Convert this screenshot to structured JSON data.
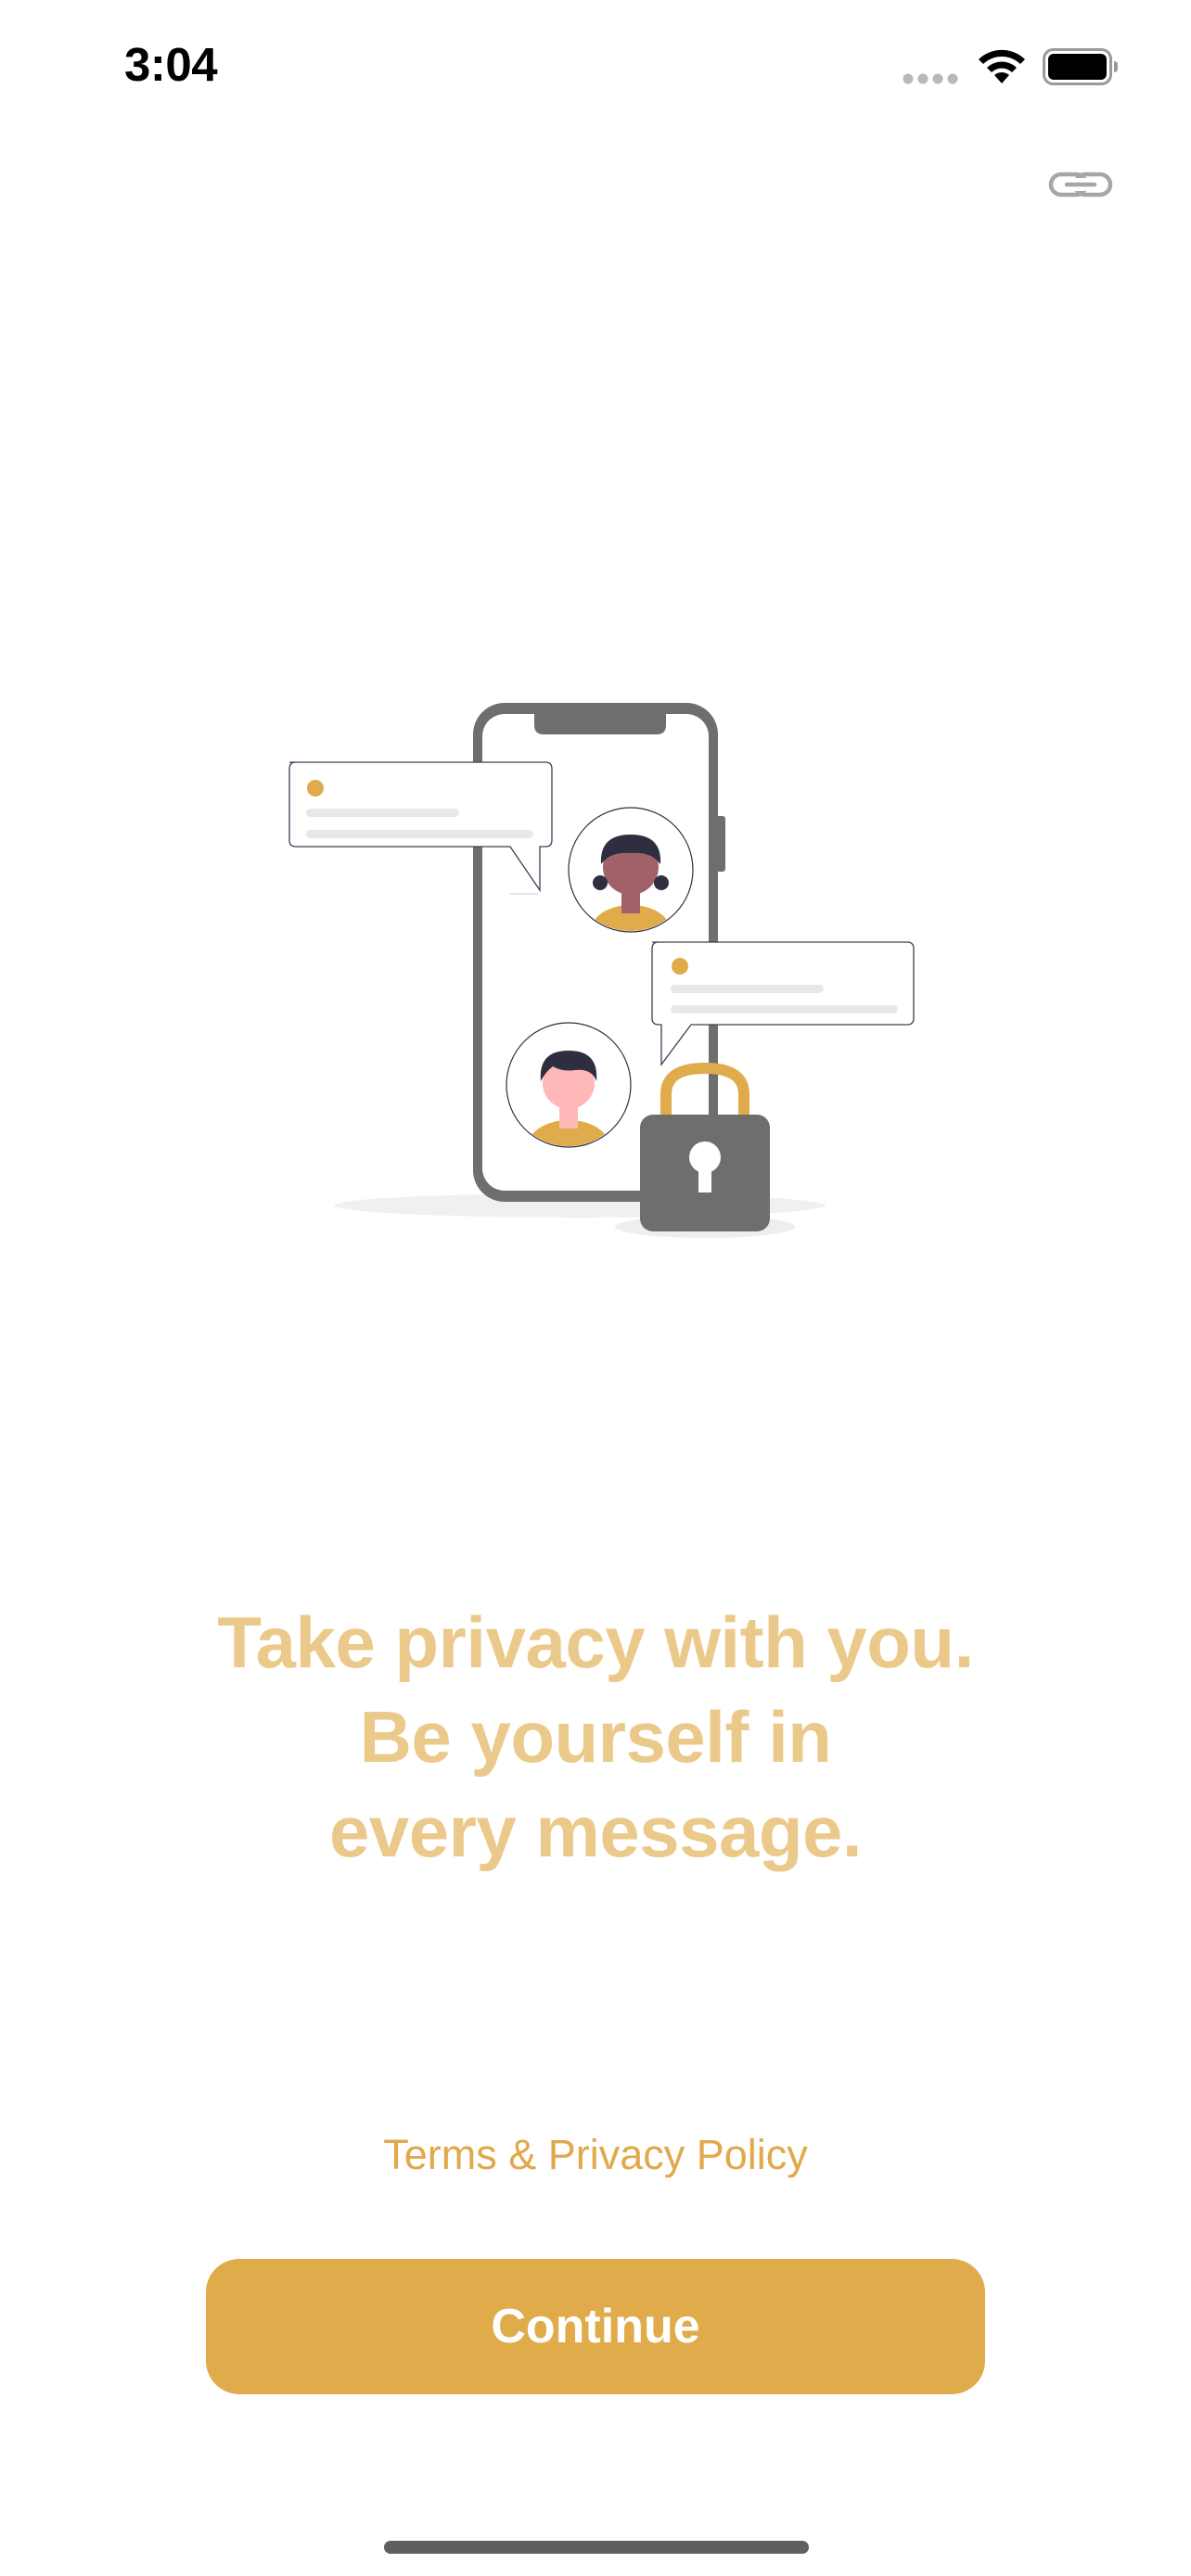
{
  "status_bar": {
    "time": "3:04",
    "icons": [
      "signal-icon",
      "wifi-icon",
      "battery-icon"
    ]
  },
  "header": {
    "link_icon": "link-icon"
  },
  "illustration": {
    "name": "privacy-messaging-illustration",
    "colors": {
      "phone": "#6e6e6e",
      "accent": "#e0ab4a",
      "bubble_line": "#e8e8e8",
      "hair": "#2f2e41",
      "skin_dark": "#a0616a",
      "skin_light": "#ffb8b8"
    }
  },
  "headline": {
    "lines": [
      "Take privacy with you.",
      "Be yourself in",
      "every message."
    ]
  },
  "footer": {
    "terms_label": "Terms & Privacy Policy",
    "continue_label": "Continue"
  },
  "colors": {
    "accent": "#e0ab4a",
    "headline": "#ebc98a",
    "background": "#ffffff"
  }
}
